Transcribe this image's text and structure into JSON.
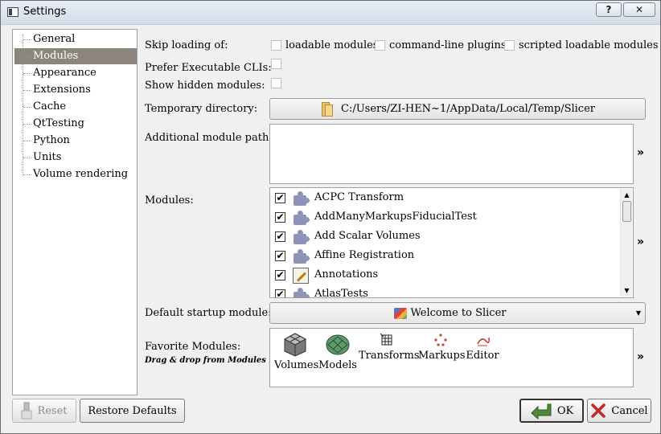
{
  "window": {
    "title": "Settings",
    "help_label": "?",
    "close_label": "✕"
  },
  "sidebar": {
    "items": [
      {
        "label": "General"
      },
      {
        "label": "Modules"
      },
      {
        "label": "Appearance"
      },
      {
        "label": "Extensions"
      },
      {
        "label": "Cache"
      },
      {
        "label": "QtTesting"
      },
      {
        "label": "Python"
      },
      {
        "label": "Units"
      },
      {
        "label": "Volume rendering"
      }
    ],
    "selected": "Modules"
  },
  "settings": {
    "skip_loading_label": "Skip loading of:",
    "skip_options": [
      {
        "label": "loadable modules",
        "checked": false
      },
      {
        "label": "command-line plugins",
        "checked": false
      },
      {
        "label": "scripted loadable modules",
        "checked": false
      }
    ],
    "prefer_cli_label": "Prefer Executable CLIs:",
    "show_hidden_label": "Show hidden modules:",
    "temp_dir_label": "Temporary directory:",
    "temp_dir_value": "C:/Users/ZI-HEN~1/AppData/Local/Temp/Slicer",
    "additional_paths_label": "Additional module paths:",
    "modules_label": "Modules:",
    "modules": [
      {
        "name": "ACPC Transform",
        "checked": true,
        "icon": "puzzle-icon"
      },
      {
        "name": "AddManyMarkupsFiducialTest",
        "checked": true,
        "icon": "puzzle-icon"
      },
      {
        "name": "Add Scalar Volumes",
        "checked": true,
        "icon": "puzzle-icon"
      },
      {
        "name": "Affine Registration",
        "checked": true,
        "icon": "puzzle-icon"
      },
      {
        "name": "Annotations",
        "checked": true,
        "icon": "annotation-icon"
      },
      {
        "name": "AtlasTests",
        "checked": true,
        "icon": "puzzle-icon"
      }
    ],
    "default_startup_label": "Default startup module:",
    "default_startup_value": "Welcome to Slicer",
    "favorites_label": "Favorite Modules:",
    "favorites_hint": "Drag & drop from Modules list",
    "favorites": [
      {
        "label": "Volumes",
        "icon": "volumes-icon"
      },
      {
        "label": "Models",
        "icon": "models-icon"
      },
      {
        "label": "Transforms",
        "icon": "transforms-icon"
      },
      {
        "label": "Markups",
        "icon": "markups-icon"
      },
      {
        "label": "Editor",
        "icon": "editor-icon"
      }
    ],
    "more_glyph": "»"
  },
  "footer": {
    "reset_label": "Reset",
    "restore_label": "Restore Defaults",
    "ok_label": "OK",
    "cancel_label": "Cancel"
  }
}
